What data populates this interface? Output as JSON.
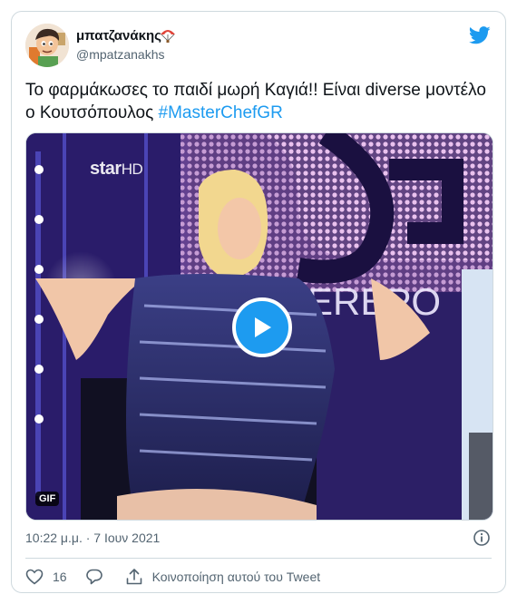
{
  "author": {
    "name": "μπατζανάκης",
    "handle": "@mpatzanakhs"
  },
  "tweet": {
    "text": "Το φαρμάκωσες το παιδί μωρή Καγιά!! Είναι diverse μοντέλο ο Κουτσόπουλος ",
    "hashtag": "#MasterChefGR"
  },
  "media": {
    "watermark_main": "star",
    "watermark_suffix": "HD",
    "badge": "GIF",
    "backdrop_letters": "EREPO"
  },
  "meta": {
    "timestamp": "10:22 μ.μ. · 7 Ιουν 2021"
  },
  "actions": {
    "like_count": "16",
    "share_label": "Κοινοποίηση αυτού του Tweet"
  },
  "colors": {
    "accent": "#1d9bf0",
    "text": "#0f1419",
    "muted": "#536471",
    "border": "#cfd9de"
  },
  "icons": [
    "twitter-bird-icon",
    "play-icon",
    "info-icon",
    "heart-icon",
    "reply-icon",
    "share-icon"
  ]
}
